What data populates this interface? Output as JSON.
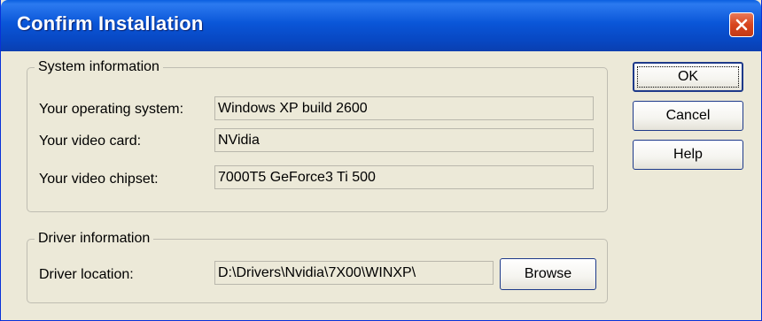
{
  "window": {
    "title": "Confirm Installation"
  },
  "system_info": {
    "legend": "System information",
    "os_label": "Your operating system:",
    "os_value": "Windows XP  build 2600",
    "video_card_label": "Your video card:",
    "video_card_value": "NVidia",
    "chipset_label": "Your video chipset:",
    "chipset_value": "7000T5 GeForce3 Ti 500"
  },
  "driver_info": {
    "legend": "Driver information",
    "location_label": "Driver location:",
    "location_value": "D:\\Drivers\\Nvidia\\7X00\\WINXP\\",
    "browse_label": "Browse"
  },
  "buttons": {
    "ok_label": "OK",
    "cancel_label": "Cancel",
    "help_label": "Help"
  },
  "colors": {
    "titlebar": "#0a56d8",
    "dialog_bg": "#ece9d8",
    "close_button": "#d8451e"
  },
  "icons": {
    "close": "close-icon"
  }
}
